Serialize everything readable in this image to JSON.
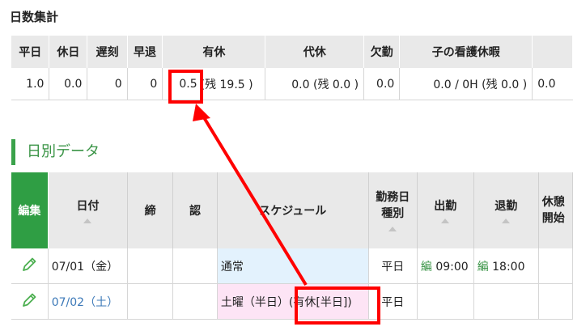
{
  "summary": {
    "title": "日数集計",
    "headers": [
      "平日",
      "休日",
      "遅刻",
      "早退",
      "有休",
      "代休",
      "欠勤",
      "子の看護休暇"
    ],
    "values": [
      "1.0",
      "0.0",
      "0",
      "0",
      "0.5",
      "(残 19.5 )",
      "0.0 (残 0.0 )",
      "0.0",
      "0.0 / 0H (残 0.0 )",
      "0.0"
    ]
  },
  "daily": {
    "section_title": "日別データ",
    "headers": {
      "edit": "編集",
      "date": "日付",
      "close": "締",
      "approve": "認",
      "schedule": "スケジュール",
      "worktype_line1": "勤務日",
      "worktype_line2": "種別",
      "clock_in": "出勤",
      "clock_out": "退勤",
      "break_line1": "休憩",
      "break_line2": "開始"
    },
    "rows": [
      {
        "date": "07/01（金）",
        "schedule": "通常",
        "worktype": "平日",
        "in_stamp": "編",
        "in_time": "09:00",
        "out_stamp": "編",
        "out_time": "18:00"
      },
      {
        "date": "07/02（土）",
        "schedule": "土曜（半日）(有休[半日])",
        "worktype": "平日"
      }
    ]
  },
  "colors": {
    "accent_green": "#2f9e44",
    "annotation_red": "#ff0000",
    "schedule_blue": "#e3f2fd",
    "schedule_pink": "#fde4f5"
  },
  "icons": [
    "pencil-icon",
    "sort-caret-icon"
  ]
}
